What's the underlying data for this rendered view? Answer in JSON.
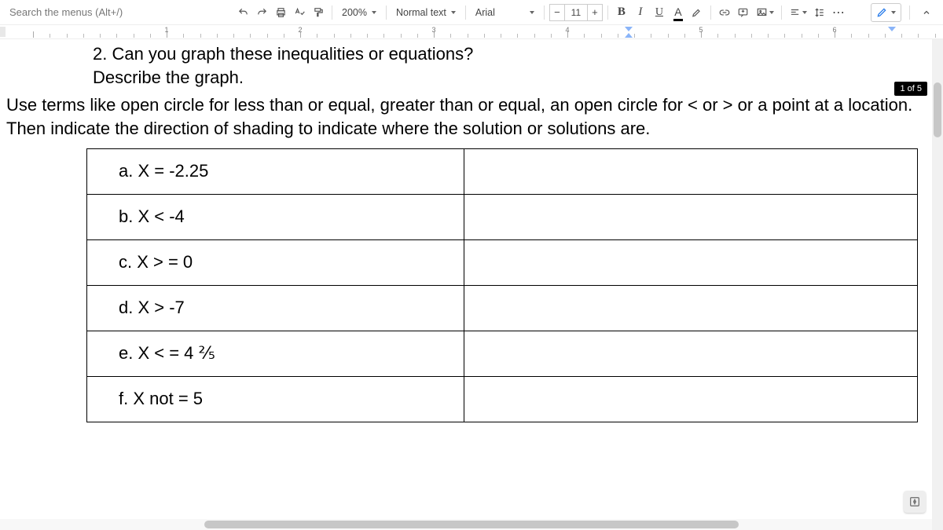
{
  "toolbar": {
    "search_placeholder": "Search the menus (Alt+/)",
    "zoom": "200%",
    "style": "Normal text",
    "font": "Arial",
    "font_size": "11",
    "bold": "B",
    "italic": "I",
    "underline": "U",
    "text_color": "A",
    "more": "⋯"
  },
  "ruler": {
    "numbers": [
      "1",
      "2",
      "3",
      "4",
      "5",
      "6"
    ]
  },
  "page_indicator": "1 of 5",
  "document": {
    "title": "2. Can you graph these inequalities or equations?",
    "subtitle": "Describe the graph.",
    "body": "Use terms like open circle for less than or equal, greater than or equal, an open circle for < or > or a point at a location. Then indicate the direction of shading to indicate where the solution or solutions are.",
    "rows": [
      {
        "label": "a.",
        "expr": "X = -2.25",
        "ans": ""
      },
      {
        "label": "b.",
        "expr": "X < -4",
        "ans": ""
      },
      {
        "label": "c.",
        "expr": "X > = 0",
        "ans": ""
      },
      {
        "label": "d.",
        "expr": "X > -7",
        "ans": ""
      },
      {
        "label": "e.",
        "expr": "X < = 4 ⅖",
        "ans": ""
      },
      {
        "label": "f.",
        "expr": " X not = 5",
        "ans": ""
      }
    ]
  }
}
